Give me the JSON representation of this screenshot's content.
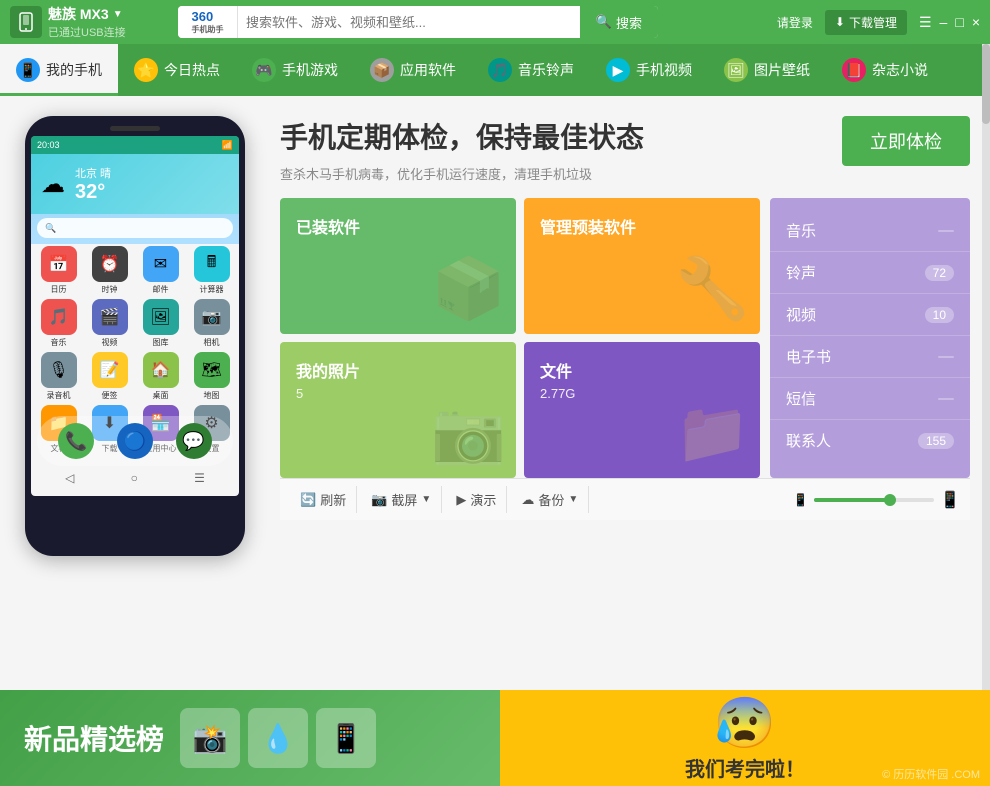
{
  "topbar": {
    "device_name": "魅族 MX3",
    "device_status": "已通过USB连接",
    "search_placeholder": "搜索软件、游戏、视频和壁纸...",
    "search_btn": "搜索",
    "login_label": "请登录",
    "download_mgr": "下载管理",
    "logo_text": "360",
    "logo_sub": "手机助手"
  },
  "nav": {
    "items": [
      {
        "label": "我的手机",
        "icon": "📱",
        "active": true
      },
      {
        "label": "今日热点",
        "icon": "⭐",
        "active": false
      },
      {
        "label": "手机游戏",
        "icon": "🎮",
        "active": false
      },
      {
        "label": "应用软件",
        "icon": "📦",
        "active": false
      },
      {
        "label": "音乐铃声",
        "icon": "🎵",
        "active": false
      },
      {
        "label": "手机视频",
        "icon": "▶",
        "active": false
      },
      {
        "label": "图片壁纸",
        "icon": "🖼",
        "active": false
      },
      {
        "label": "杂志小说",
        "icon": "📕",
        "active": false
      }
    ]
  },
  "hero": {
    "title": "手机定期体检，保持最佳状态",
    "subtitle": "查杀木马手机病毒，优化手机运行速度，清理手机垃圾",
    "check_btn": "立即体检"
  },
  "tiles": [
    {
      "label": "已装软件",
      "sub": "",
      "color": "green",
      "icon": "📦"
    },
    {
      "label": "管理预装软件",
      "sub": "",
      "color": "orange",
      "icon": "🔧"
    },
    {
      "label": "我的照片",
      "sub": "5",
      "color": "lime",
      "icon": "📷"
    },
    {
      "label": "文件",
      "sub": "2.77G",
      "color": "purple",
      "icon": "📁"
    }
  ],
  "sidebar": {
    "items": [
      {
        "label": "音乐",
        "badge": ""
      },
      {
        "label": "铃声",
        "badge": "72"
      },
      {
        "label": "视频",
        "badge": "10"
      },
      {
        "label": "电子书",
        "badge": ""
      },
      {
        "label": "短信",
        "badge": ""
      },
      {
        "label": "联系人",
        "badge": "155"
      }
    ]
  },
  "toolbar": {
    "refresh": "刷新",
    "screenshot": "截屏",
    "demo": "演示",
    "backup": "备份"
  },
  "phone": {
    "time": "20:03",
    "city": "北京 晴",
    "temp": "32°",
    "apps": [
      {
        "icon": "📅",
        "label": "日历",
        "bg": "#ef5350"
      },
      {
        "icon": "⏰",
        "label": "时钟",
        "bg": "#424242"
      },
      {
        "icon": "✉",
        "label": "邮件",
        "bg": "#42a5f5"
      },
      {
        "icon": "🖩",
        "label": "计算器",
        "bg": "#26c6da"
      },
      {
        "icon": "🎵",
        "label": "音乐",
        "bg": "#ef5350"
      },
      {
        "icon": "🎬",
        "label": "视频",
        "bg": "#5c6bc0"
      },
      {
        "icon": "🖼",
        "label": "图库",
        "bg": "#26a69a"
      },
      {
        "icon": "📷",
        "label": "相机",
        "bg": "#78909c"
      },
      {
        "icon": "🎙",
        "label": "录音机",
        "bg": "#78909c"
      },
      {
        "icon": "📝",
        "label": "便签",
        "bg": "#ffca28"
      },
      {
        "icon": "🏠",
        "label": "桌面",
        "bg": "#8bc34a"
      },
      {
        "icon": "🗺",
        "label": "地图",
        "bg": "#4caf50"
      },
      {
        "icon": "📁",
        "label": "文档",
        "bg": "#ff9800"
      },
      {
        "icon": "⬇",
        "label": "下载",
        "bg": "#42a5f5"
      },
      {
        "icon": "🏪",
        "label": "应用中心",
        "bg": "#7e57c2"
      },
      {
        "icon": "⚙",
        "label": "设置",
        "bg": "#78909c"
      }
    ],
    "dock": [
      {
        "icon": "📞",
        "bg": "#4caf50"
      },
      {
        "icon": "🔵",
        "bg": "#2196f3"
      },
      {
        "icon": "💬",
        "bg": "#4caf50"
      }
    ]
  },
  "banner": {
    "left_title": "新品精选榜",
    "right_text": "我们考完啦！",
    "watermark": "© 历历软件园 .COM"
  },
  "window_controls": {
    "min": "–",
    "max": "□",
    "close": "×"
  }
}
